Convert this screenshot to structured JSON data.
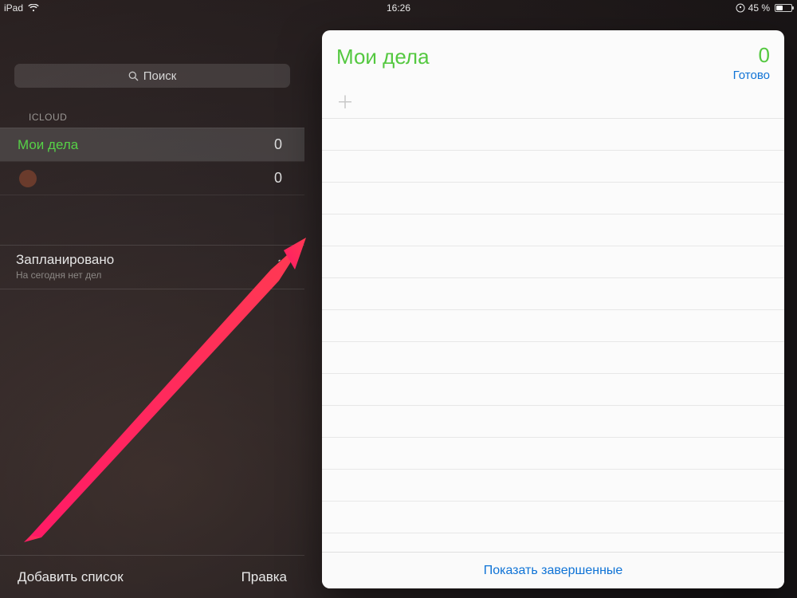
{
  "status": {
    "device": "iPad",
    "time": "16:26",
    "battery_text": "45 %"
  },
  "sidebar": {
    "search_placeholder": "Поиск",
    "section": "ICLOUD",
    "lists": [
      {
        "label": "Мои дела",
        "count": "0"
      },
      {
        "label": "",
        "count": "0"
      }
    ],
    "scheduled": {
      "title": "Запланировано",
      "subtitle": "На сегодня нет дел"
    },
    "bottom": {
      "add_list": "Добавить список",
      "edit": "Правка"
    }
  },
  "card": {
    "title": "Мои дела",
    "count": "0",
    "done": "Готово",
    "footer_link": "Показать завершенные"
  }
}
